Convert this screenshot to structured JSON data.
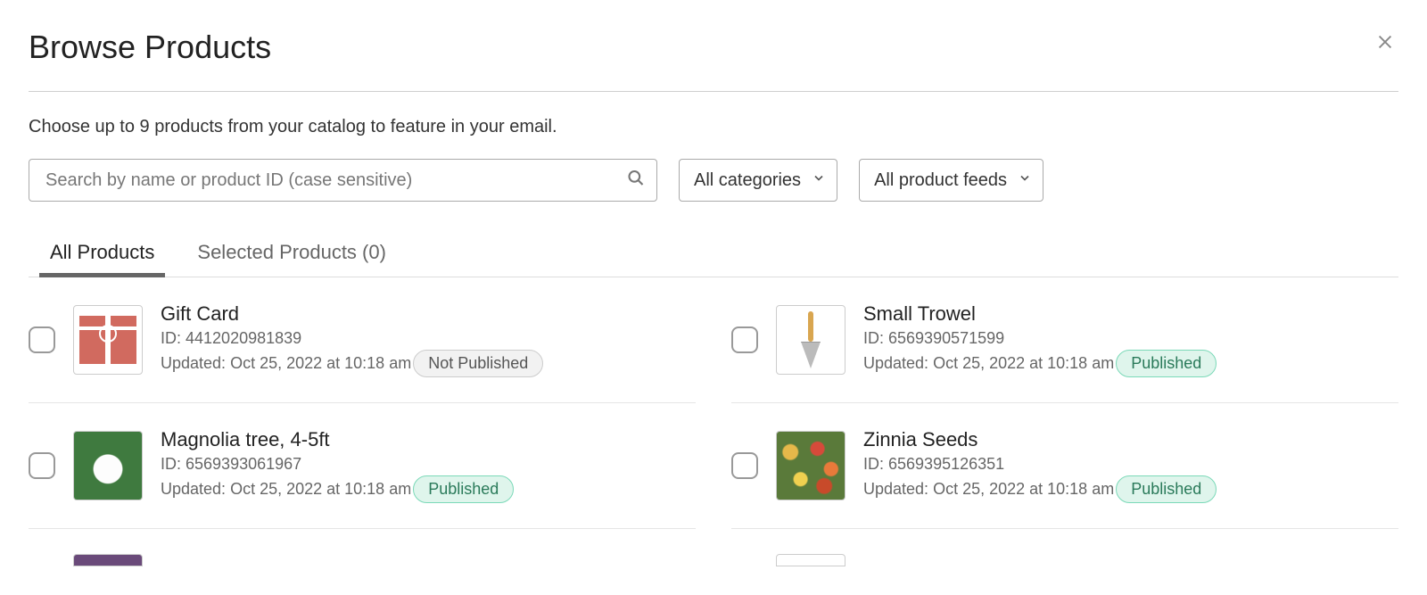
{
  "title": "Browse Products",
  "subtitle": "Choose up to 9 products from your catalog to feature in your email.",
  "search": {
    "placeholder": "Search by name or product ID (case sensitive)",
    "value": ""
  },
  "filters": {
    "categories": "All categories",
    "feeds": "All product feeds"
  },
  "tabs": {
    "all": "All Products",
    "selected_prefix": "Selected Products (",
    "selected_count": "0",
    "selected_suffix": ")"
  },
  "labels": {
    "id_prefix": "ID: ",
    "updated_prefix": "Updated: "
  },
  "status": {
    "published": "Published",
    "not_published": "Not Published"
  },
  "products": [
    {
      "name": "Gift Card",
      "id": "4412020981839",
      "updated": "Oct 25, 2022 at 10:18 am",
      "published": false,
      "thumb": "gift"
    },
    {
      "name": "Small Trowel",
      "id": "6569390571599",
      "updated": "Oct 25, 2022 at 10:18 am",
      "published": true,
      "thumb": "trowel"
    },
    {
      "name": "Magnolia tree, 4-5ft",
      "id": "6569393061967",
      "updated": "Oct 25, 2022 at 10:18 am",
      "published": true,
      "thumb": "magnolia"
    },
    {
      "name": "Zinnia Seeds",
      "id": "6569395126351",
      "updated": "Oct 25, 2022 at 10:18 am",
      "published": true,
      "thumb": "zinnia"
    }
  ]
}
